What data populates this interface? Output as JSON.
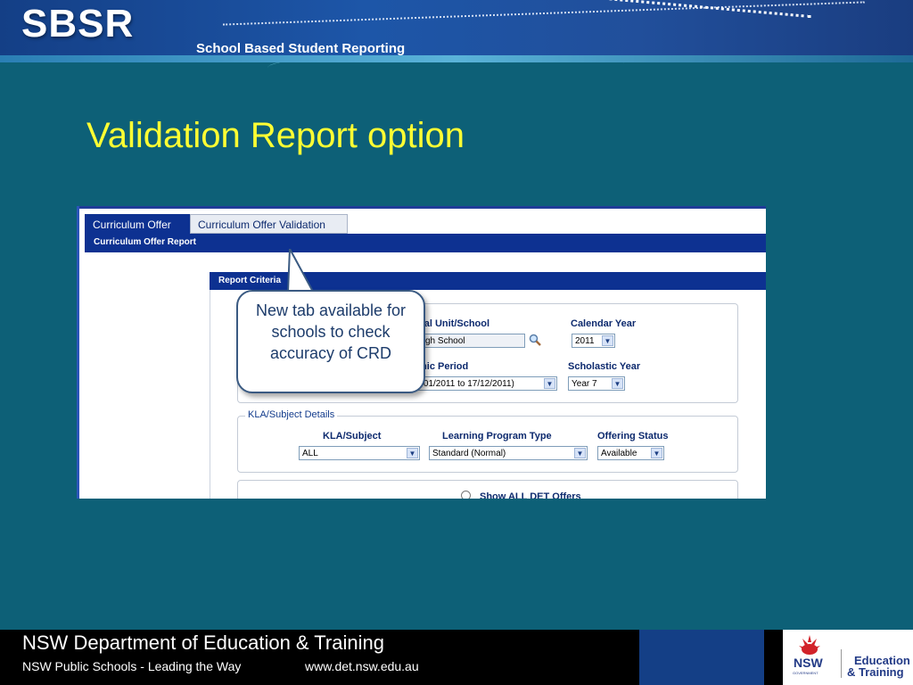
{
  "header": {
    "logo_text": "SBSR",
    "subtitle": "School Based Student Reporting"
  },
  "slide": {
    "title": "Validation Report option"
  },
  "screenshot": {
    "tabs": [
      {
        "label": "Curriculum Offer",
        "active": true
      },
      {
        "label": "Curriculum Offer Validation",
        "active": false
      }
    ],
    "section_title": "Curriculum Offer Report",
    "report_criteria": {
      "heading": "Report Criteria",
      "org_unit_label": "nal Unit/School",
      "org_unit_value": "gh School",
      "calendar_year_label": "Calendar Year",
      "calendar_year_value": "2011",
      "academic_period_label": "mic Period",
      "academic_period_value": "21/01/2011 to 17/12/2011)",
      "scholastic_year_label": "Scholastic Year",
      "scholastic_year_value": "Year 7"
    },
    "kla_details": {
      "legend": "KLA/Subject Details",
      "kla_label": "KLA/Subject",
      "kla_value": "ALL",
      "program_type_label": "Learning Program Type",
      "program_type_value": "Standard (Normal)",
      "offering_status_label": "Offering Status",
      "offering_status_value": "Available"
    },
    "show_all_label": "Show ALL DET Offers",
    "callout": "New tab available for schools to check accuracy of CRD"
  },
  "footer": {
    "title": "NSW Department of Education & Training",
    "subtitle": "NSW Public Schools - Leading the Way",
    "url": "www.det.nsw.edu.au",
    "logo_nsw": "NSW",
    "logo_gov": "GOVERNMENT",
    "logo_edu_1": "Education",
    "logo_edu_2": "& Training"
  },
  "colors": {
    "background": "#0d6077",
    "title": "#ffff33",
    "app_blue": "#0d3191"
  }
}
